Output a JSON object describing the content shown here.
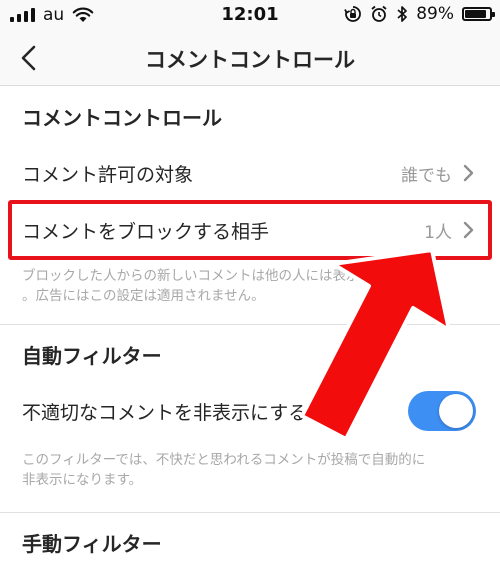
{
  "status_bar": {
    "carrier": "au",
    "time": "12:01",
    "battery": "89%",
    "battery_level": 0.89
  },
  "nav": {
    "title": "コメントコントロール",
    "back_icon": "chevron-left-icon"
  },
  "sections": {
    "comment_control": {
      "header": "コメントコントロール",
      "allow_from": {
        "label": "コメント許可の対象",
        "value": "誰でも"
      },
      "block_from": {
        "label": "コメントをブロックする相手",
        "value": "1人"
      },
      "helper_line1": "ブロックした人からの新しいコメントは他の人には表示されません",
      "helper_line2": "。広告にはこの設定は適用されません。"
    },
    "auto_filter": {
      "header": "自動フィルター",
      "hide_offensive": {
        "label": "不適切なコメントを非表示にする",
        "enabled": true
      },
      "helper_line1": "このフィルターでは、不快だと思われるコメントが投稿で自動的に",
      "helper_line2": "非表示になります。"
    },
    "manual_filter": {
      "header": "手動フィルター"
    }
  },
  "colors": {
    "toggle_on": "#3d8ff3",
    "highlight": "#e8121b",
    "arrow": "#f20c0c"
  }
}
